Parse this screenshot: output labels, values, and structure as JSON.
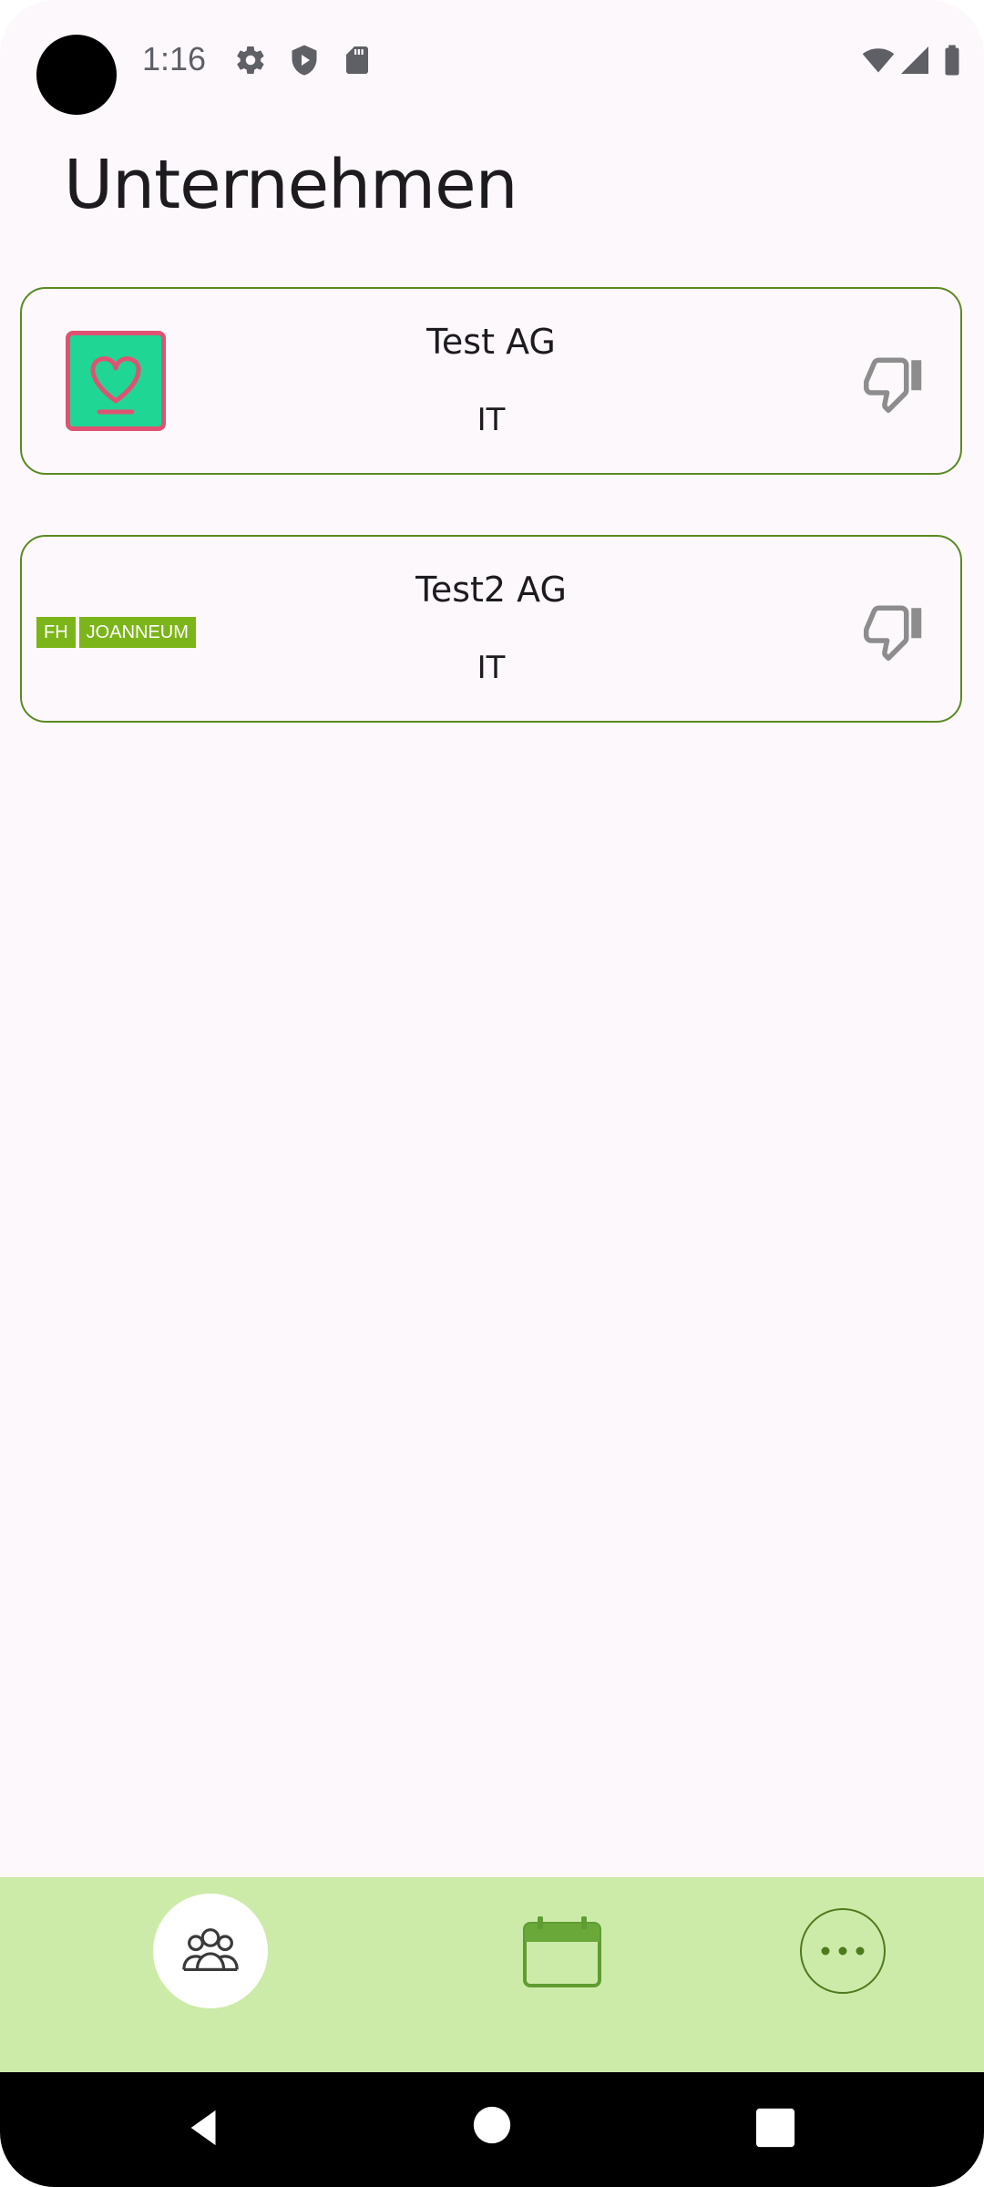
{
  "status_bar": {
    "time": "1:16",
    "icons": [
      "settings-icon",
      "shield-play-icon",
      "sd-card-icon",
      "wifi-icon",
      "signal-icon",
      "battery-icon"
    ]
  },
  "page": {
    "title": "Unternehmen"
  },
  "companies": [
    {
      "name": "Test AG",
      "industry": "IT",
      "logo": "heart-logo",
      "action_icon": "thumb-down-icon"
    },
    {
      "name": "Test2 AG",
      "industry": "IT",
      "logo": "fh-joanneum-logo",
      "logo_text": [
        "FH",
        "JOANNEUM"
      ],
      "action_icon": "thumb-down-icon"
    }
  ],
  "bottom_nav": {
    "items": [
      {
        "icon": "people-icon",
        "active": true
      },
      {
        "icon": "calendar-icon",
        "active": false
      },
      {
        "icon": "more-icon",
        "active": false
      }
    ]
  },
  "system_nav": {
    "buttons": [
      "back-icon",
      "home-icon",
      "recents-icon"
    ]
  },
  "colors": {
    "background": "#fdf8fc",
    "card_border": "#5a8a22",
    "nav_background": "#cdeba8",
    "logo_green": "#7cb519",
    "heart_logo_bg": "#1fd694",
    "heart_logo_border": "#e05272"
  }
}
